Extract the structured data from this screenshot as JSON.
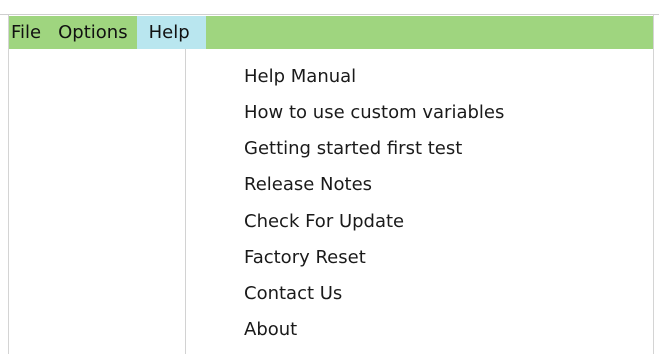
{
  "menubar": {
    "file_label": "File",
    "options_label": "Options",
    "help_label": "Help",
    "bar_color": "#9fd57f",
    "active_item_color": "#b9e6ef"
  },
  "help_menu": {
    "items": [
      {
        "label": "Help Manual"
      },
      {
        "label": "How to use custom variables"
      },
      {
        "label": "Getting started first test"
      },
      {
        "label": "Release Notes"
      },
      {
        "label": "Check For Update"
      },
      {
        "label": "Factory Reset"
      },
      {
        "label": "Contact Us"
      },
      {
        "label": "About"
      }
    ]
  }
}
